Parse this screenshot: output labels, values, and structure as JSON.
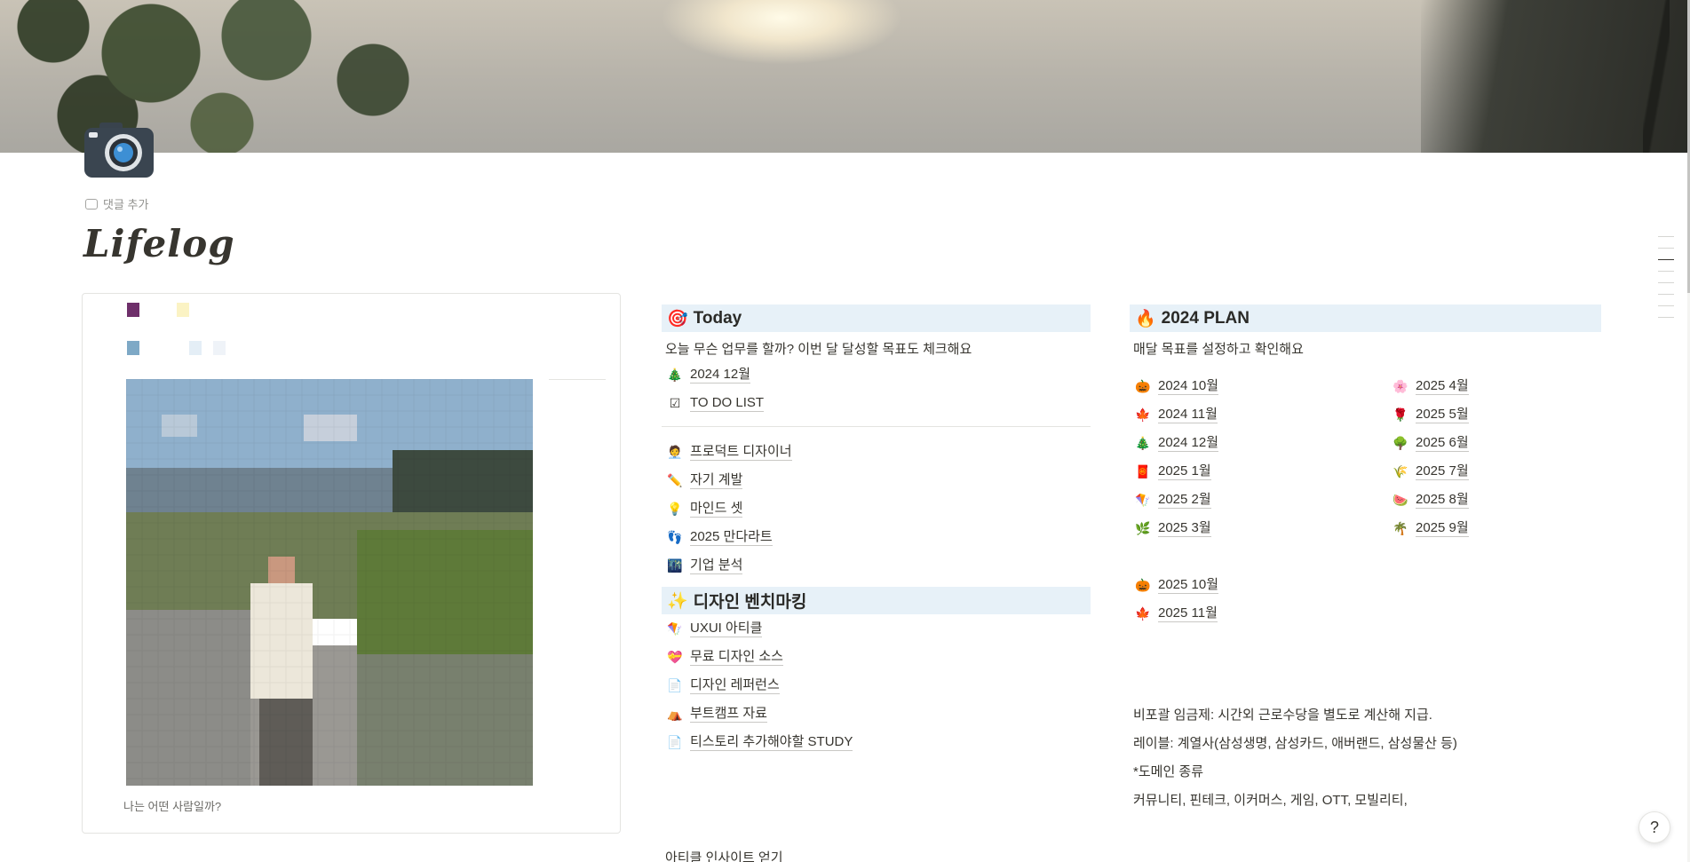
{
  "page": {
    "title": "Lifelog",
    "add_comment": "댓글 추가",
    "page_icon": "camera-icon"
  },
  "profile": {
    "caption": "나는 어떤 사람일까?",
    "swatch_colors": [
      "#6e2f6a",
      "#fbf3c4",
      "#7ea9c6",
      "#e4eef6",
      "#eff3f8"
    ]
  },
  "today": {
    "icon": "🎯",
    "title": "Today",
    "description": "오늘 무슨 업무를 할까? 이번 달 달성할 목표도 체크해요",
    "top_links": [
      {
        "icon": "🎄",
        "label": "2024 12월"
      },
      {
        "icon": "☑",
        "label": "TO DO LIST"
      }
    ],
    "links": [
      {
        "icon": "🧑‍💼",
        "label": "프로덕트 디자이너"
      },
      {
        "icon": "✏️",
        "label": "자기 계발"
      },
      {
        "icon": "💡",
        "label": "마인드 셋"
      },
      {
        "icon": "👣",
        "label": "2025 만다라트"
      },
      {
        "icon": "🌃",
        "label": "기업 분석"
      }
    ]
  },
  "benchmark": {
    "icon": "✨",
    "title": "디자인 벤치마킹",
    "links": [
      {
        "icon": "🪁",
        "label": "UXUI 아티클"
      },
      {
        "icon": "💝",
        "label": "무료 디자인 소스"
      },
      {
        "icon": "📄",
        "label": "디자인 레퍼런스"
      },
      {
        "icon": "⛺",
        "label": "부트캠프 자료"
      },
      {
        "icon": "📄",
        "label": "티스토리 추가해야할 STUDY"
      }
    ],
    "footer_text": "아티클 인사이트 얻기"
  },
  "plan": {
    "icon": "🔥",
    "title": "2024 PLAN",
    "description": "매달 목표를 설정하고 확인해요",
    "months_left": [
      {
        "icon": "🎃",
        "label": "2024 10월"
      },
      {
        "icon": "🍁",
        "label": "2024 11월"
      },
      {
        "icon": "🎄",
        "label": "2024 12월"
      },
      {
        "icon": "🧧",
        "label": "2025 1월"
      },
      {
        "icon": "🪁",
        "label": "2025 2월"
      },
      {
        "icon": "🌿",
        "label": "2025 3월"
      }
    ],
    "months_right": [
      {
        "icon": "🌸",
        "label": "2025 4월"
      },
      {
        "icon": "🌹",
        "label": "2025 5월"
      },
      {
        "icon": "🌳",
        "label": "2025 6월"
      },
      {
        "icon": "🌾",
        "label": "2025 7월"
      },
      {
        "icon": "🍉",
        "label": "2025 8월"
      },
      {
        "icon": "🌴",
        "label": "2025 9월"
      }
    ],
    "months_extra": [
      {
        "icon": "🎃",
        "label": "2025 10월"
      },
      {
        "icon": "🍁",
        "label": "2025 11월"
      }
    ],
    "notes": [
      "비포괄 임금제: 시간외 근로수당을 별도로 계산해 지급.",
      "레이블: 계열사(삼성생명, 삼성카드, 애버랜드, 삼성물산 등)",
      "*도메인 종류",
      "커뮤니티, 핀테크, 이커머스, 게임, OTT, 모빌리티,"
    ]
  },
  "help": {
    "label": "?"
  }
}
